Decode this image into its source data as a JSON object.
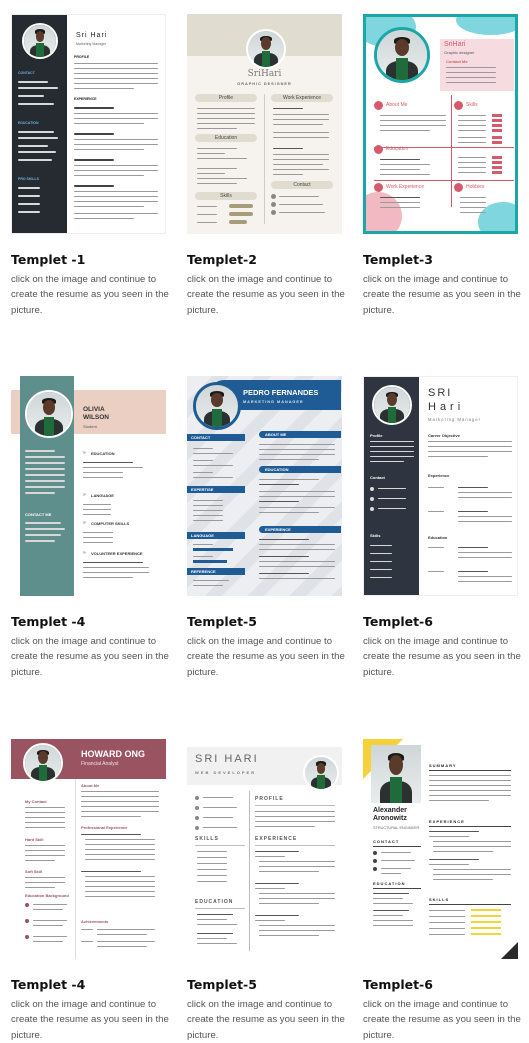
{
  "cards": [
    {
      "title": "Templet -1",
      "desc": "click on the image and continue to create the resume as you seen in the picture.",
      "preview": {
        "name": "Sri Hari",
        "role": "Marketing Manager",
        "s1": "PROFILE",
        "s2": "EXPERIENCE",
        "side1": "CONTACT",
        "side2": "EDUCATION",
        "side3": "PRO SKILLS"
      }
    },
    {
      "title": "Templet-2",
      "desc": "click on the image and continue to create the resume as you seen in the picture.",
      "preview": {
        "name": "SriHari",
        "role": "GRAPHIC DESIGNER",
        "s1": "Profile",
        "s2": "Work Experience",
        "s3": "Education",
        "s4": "Contact",
        "s5": "Skills"
      }
    },
    {
      "title": "Templet-3",
      "desc": "click on the image and continue to create the resume as you seen in the picture.",
      "preview": {
        "name": "SriHari",
        "role": "Graphic designer",
        "s0": "Contact Me",
        "s1": "About Me",
        "s2": "Skills",
        "s3": "Education",
        "s4": "Work Experience",
        "s5": "Hobbies"
      }
    },
    {
      "title": "Templet -4",
      "desc": "click on the image and continue to create the resume as you seen in the picture.",
      "preview": {
        "first": "OLIVIA",
        "last": "WILSON",
        "role": "Student",
        "s1": "EDUCATION",
        "s2": "LANGUAGE",
        "s3": "COMPUTER SKILLS",
        "s4": "VOLUNTEER EXPERIENCE",
        "side1": "CONTACT ME"
      }
    },
    {
      "title": "Templet-5",
      "desc": "click on the image and continue to create the resume as you seen in the picture.",
      "preview": {
        "name": "PEDRO FERNANDES",
        "role": "MARKETING MANAGER",
        "s1": "ABOUT ME",
        "s2": "EDUCATION",
        "s3": "EXPERIENCE",
        "side1": "CONTACT",
        "side2": "EXPERTISE",
        "side3": "LANGUAGE",
        "side4": "REFERENCE"
      }
    },
    {
      "title": "Templet-6",
      "desc": "click on the image and continue to create the resume as you seen in the picture.",
      "preview": {
        "first": "SRI",
        "last": "Hari",
        "role": "Marketing Manager",
        "s1": "Career Objective",
        "s2": "Experience",
        "s3": "Education",
        "side1": "Profile",
        "side2": "Contact",
        "side3": "Skills"
      }
    },
    {
      "title": "Templet -4",
      "desc": "click on the image and continue to create the resume as you seen in the picture.",
      "preview": {
        "name": "HOWARD ONG",
        "role": "Financial Analyst",
        "s1": "About Me",
        "s2": "Professional Experience",
        "s3": "Achievements",
        "side1": "My Contact",
        "side2": "Hard Skill",
        "side3": "Soft Skill",
        "side4": "Education Background"
      }
    },
    {
      "title": "Templet-5",
      "desc": "click on the image and continue to create the resume as you seen in the picture.",
      "preview": {
        "name": "SRI HARI",
        "role": "WEB DEVELOPER",
        "s1": "PROFILE",
        "s2": "EXPERIENCE",
        "side1": "SKILLS",
        "side2": "EDUCATION"
      }
    },
    {
      "title": "Templet-6",
      "desc": "click on the image and continue to create the resume as you seen in the picture.",
      "preview": {
        "first": "Alexander",
        "last": "Aronowitz",
        "role": "STRUCTURAL ENGINEER",
        "s1": "SUMMARY",
        "s2": "EXPERIENCE",
        "s3": "SKILLS",
        "side1": "CONTACT",
        "side2": "EDUCATION"
      }
    }
  ]
}
